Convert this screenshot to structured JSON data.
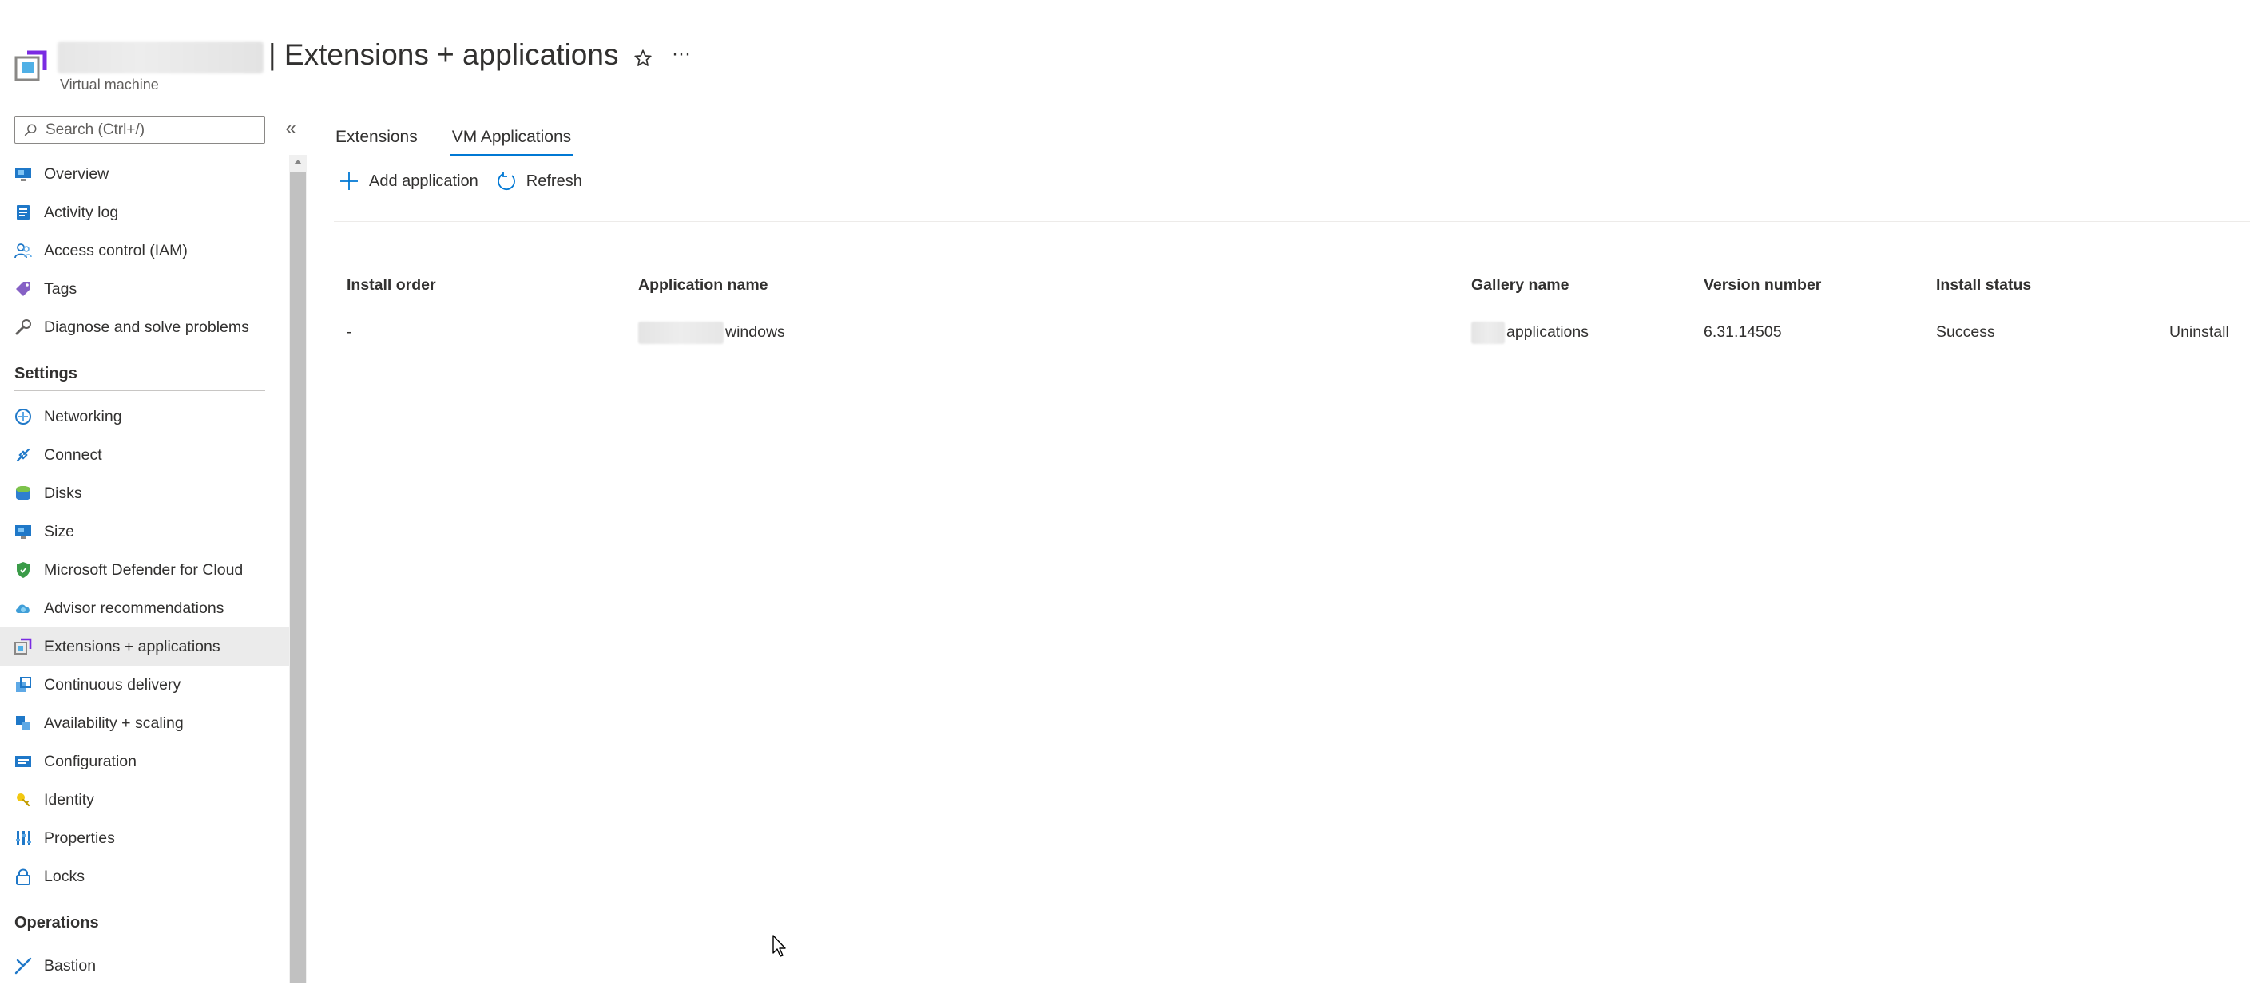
{
  "header": {
    "title": "| Extensions + applications",
    "subtitle": "Virtual machine",
    "more_label": "···"
  },
  "search": {
    "placeholder": "Search (Ctrl+/)",
    "collapse_label": "«"
  },
  "sidebar": {
    "top_items": [
      {
        "label": "Overview",
        "icon": "monitor-icon"
      },
      {
        "label": "Activity log",
        "icon": "activity-log-icon"
      },
      {
        "label": "Access control (IAM)",
        "icon": "people-icon"
      },
      {
        "label": "Tags",
        "icon": "tag-icon"
      },
      {
        "label": "Diagnose and solve problems",
        "icon": "wrench-icon"
      }
    ],
    "settings_heading": "Settings",
    "settings_items": [
      {
        "label": "Networking",
        "icon": "networking-icon"
      },
      {
        "label": "Connect",
        "icon": "connect-icon"
      },
      {
        "label": "Disks",
        "icon": "disks-icon"
      },
      {
        "label": "Size",
        "icon": "size-monitor-icon"
      },
      {
        "label": "Microsoft Defender for Cloud",
        "icon": "shield-icon"
      },
      {
        "label": "Advisor recommendations",
        "icon": "advisor-cloud-icon"
      },
      {
        "label": "Extensions + applications",
        "icon": "extensions-icon",
        "active": true
      },
      {
        "label": "Continuous delivery",
        "icon": "delivery-icon"
      },
      {
        "label": "Availability + scaling",
        "icon": "scaling-icon"
      },
      {
        "label": "Configuration",
        "icon": "configuration-icon"
      },
      {
        "label": "Identity",
        "icon": "identity-key-icon"
      },
      {
        "label": "Properties",
        "icon": "properties-icon"
      },
      {
        "label": "Locks",
        "icon": "lock-icon"
      }
    ],
    "operations_heading": "Operations",
    "operations_items": [
      {
        "label": "Bastion",
        "icon": "bastion-icon"
      }
    ]
  },
  "tabs": [
    {
      "label": "Extensions",
      "selected": false
    },
    {
      "label": "VM Applications",
      "selected": true
    }
  ],
  "toolbar": {
    "add_label": "Add application",
    "refresh_label": "Refresh"
  },
  "table": {
    "columns": [
      "Install order",
      "Application name",
      "Gallery name",
      "Version number",
      "Install status"
    ],
    "rows": [
      {
        "install_order": "-",
        "application_name": "windows",
        "gallery_name": "applications",
        "version_number": "6.31.14505",
        "install_status": "Success",
        "action": "Uninstall"
      }
    ]
  },
  "colors": {
    "accent": "#0078d4",
    "active_nav_bg": "#ebebeb",
    "text": "#323130"
  }
}
